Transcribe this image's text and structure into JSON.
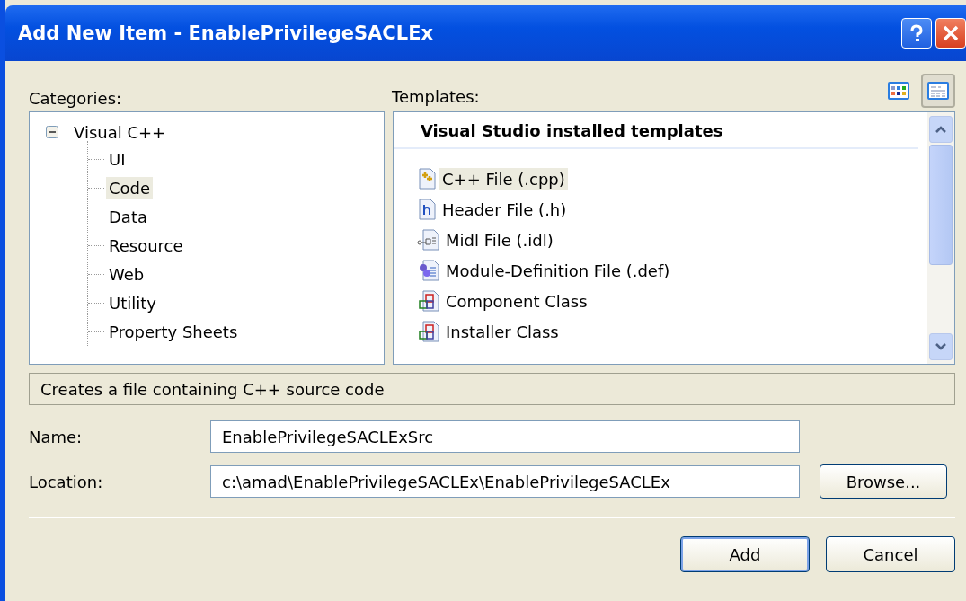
{
  "window": {
    "title": "Add New Item - EnablePrivilegeSACLEx"
  },
  "categories": {
    "label": "Categories:",
    "tree": [
      {
        "label": "Visual C++",
        "expanded": true,
        "selected": false,
        "children": [
          {
            "label": "UI",
            "selected": false
          },
          {
            "label": "Code",
            "selected": true
          },
          {
            "label": "Data",
            "selected": false
          },
          {
            "label": "Resource",
            "selected": false
          },
          {
            "label": "Web",
            "selected": false
          },
          {
            "label": "Utility",
            "selected": false
          },
          {
            "label": "Property Sheets",
            "selected": false
          }
        ]
      }
    ]
  },
  "templates": {
    "label": "Templates:",
    "view_buttons": [
      {
        "kind": "large-icons",
        "selected": false
      },
      {
        "kind": "small-icons",
        "selected": true
      }
    ],
    "group": "Visual Studio installed templates",
    "items": [
      {
        "label": "C++ File (.cpp)",
        "kind": "cpp",
        "selected": true
      },
      {
        "label": "Header File (.h)",
        "kind": "header",
        "selected": false
      },
      {
        "label": "Midl File (.idl)",
        "kind": "idl",
        "selected": false
      },
      {
        "label": "Module-Definition File (.def)",
        "kind": "def",
        "selected": false
      },
      {
        "label": "Component Class",
        "kind": "class",
        "selected": false
      },
      {
        "label": "Installer Class",
        "kind": "class",
        "selected": false
      }
    ]
  },
  "description": "Creates a file containing C++ source code",
  "fields": [
    {
      "label": "Name:",
      "value": "EnablePrivilegeSACLExSrc"
    },
    {
      "label": "Location:",
      "value": "c:\\amad\\EnablePrivilegeSACLEx\\EnablePrivilegeSACLEx",
      "button": "Browse..."
    }
  ],
  "buttons": [
    {
      "label": "Add",
      "default": true
    },
    {
      "label": "Cancel",
      "default": false
    }
  ]
}
